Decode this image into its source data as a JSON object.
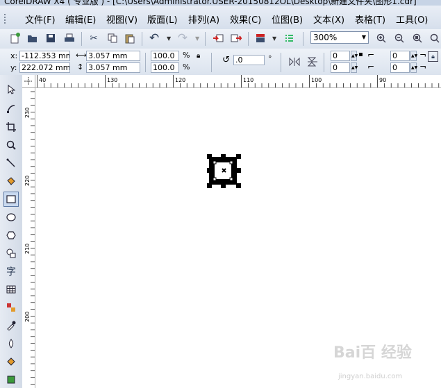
{
  "window": {
    "title": "CorelDRAW X4 ( 专业版 ) - [C:\\Users\\Administrator.USER-20150812OL\\Desktop\\新建文件夹\\图形1.cdr]"
  },
  "menu": [
    {
      "label": "文件(F)"
    },
    {
      "label": "编辑(E)"
    },
    {
      "label": "视图(V)"
    },
    {
      "label": "版面(L)"
    },
    {
      "label": "排列(A)"
    },
    {
      "label": "效果(C)"
    },
    {
      "label": "位图(B)"
    },
    {
      "label": "文本(X)"
    },
    {
      "label": "表格(T)"
    },
    {
      "label": "工具(O)"
    }
  ],
  "standard_toolbar": {
    "zoom": "300%",
    "icons": [
      "new-document-icon",
      "open-icon",
      "save-icon",
      "print-icon",
      "cut-icon",
      "copy-icon",
      "paste-icon",
      "undo-icon",
      "redo-icon",
      "import-icon",
      "export-icon",
      "application-launcher-icon",
      "welcome-screen-icon",
      "zoom-in-icon",
      "zoom-out-icon",
      "zoom-to-selection-icon",
      "zoom-fit-icon"
    ]
  },
  "property_bar": {
    "x_label": "x:",
    "x_value": "-112.353 mm",
    "y_label": "y:",
    "y_value": "222.072 mm",
    "width_value": "3.057 mm",
    "height_value": "3.057 mm",
    "scale_x": "100.0",
    "scale_y": "100.0",
    "percent": "%",
    "rotation": ".0",
    "degree": "°",
    "corner_a_top": "0",
    "corner_a_bottom": "0",
    "corner_b_top": "0",
    "corner_b_bottom": "0"
  },
  "toolbox": {
    "tools": [
      "pick-tool-icon",
      "shape-tool-icon",
      "crop-tool-icon",
      "zoom-tool-icon",
      "freehand-tool-icon",
      "smart-fill-tool-icon",
      "rectangle-tool-icon",
      "ellipse-tool-icon",
      "polygon-tool-icon",
      "basic-shapes-tool-icon",
      "text-tool-icon",
      "table-tool-icon",
      "interactive-blend-tool-icon",
      "eyedropper-tool-icon",
      "outline-tool-icon",
      "fill-tool-icon",
      "interactive-fill-tool-icon"
    ],
    "text_tool_glyph": "字",
    "active_tool": "rectangle-tool-icon"
  },
  "rulers": {
    "horizontal_labels": [
      "40",
      "130",
      "120",
      "110",
      "100",
      "90"
    ],
    "vertical_labels": [
      "230",
      "220",
      "210",
      "200"
    ]
  },
  "watermark": {
    "text": "Bai百 经验",
    "sub": "jingyan.baidu.com"
  }
}
